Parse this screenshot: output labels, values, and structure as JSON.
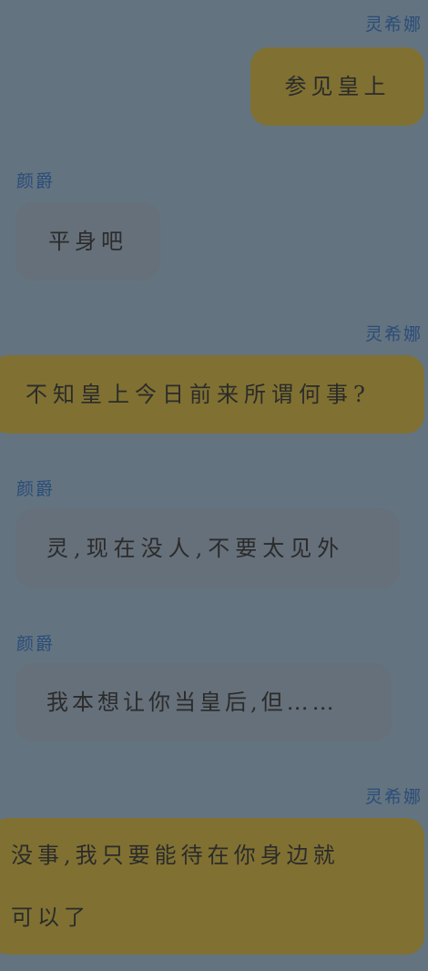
{
  "messages": [
    {
      "sender": "灵希娜",
      "side": "right",
      "text": "参见皇上"
    },
    {
      "sender": "颜爵",
      "side": "left",
      "text": "平身吧"
    },
    {
      "sender": "灵希娜",
      "side": "right",
      "text": "不知皇上今日前来所谓何事?"
    },
    {
      "sender": "颜爵",
      "side": "left",
      "text": "灵,现在没人,不要太见外"
    },
    {
      "sender": "颜爵",
      "side": "left",
      "text": "我本想让你当皇后,但……"
    },
    {
      "sender": "灵希娜",
      "side": "right",
      "lines": [
        "没事,我只要能待在你身边就",
        "可以了"
      ]
    }
  ],
  "colors": {
    "background": "#637380",
    "right_bubble": "#807132",
    "left_bubble": "#66707a",
    "name": "#2b4d78"
  }
}
